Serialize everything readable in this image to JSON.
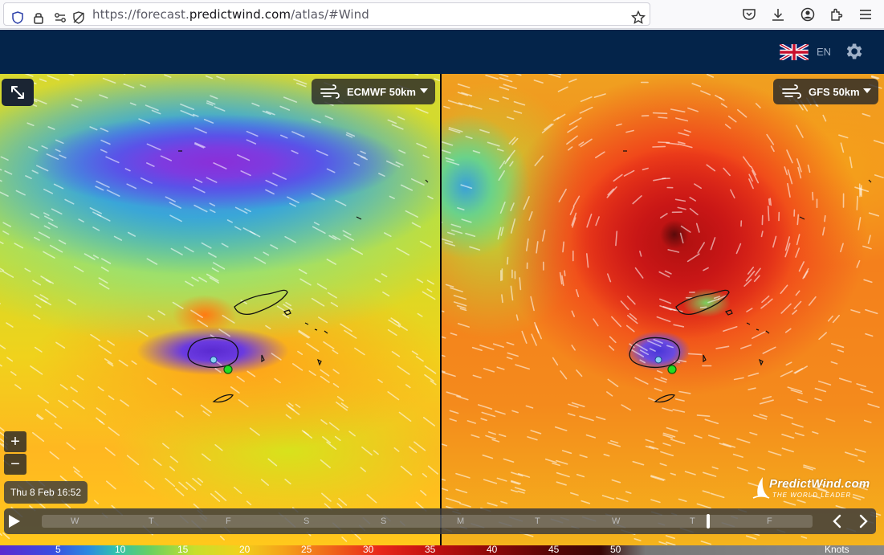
{
  "browser": {
    "url_prefix": "https://forecast.",
    "url_domain": "predictwind.com",
    "url_suffix": "/atlas/#Wind"
  },
  "header": {
    "language": "EN"
  },
  "models": {
    "left": "ECMWF 50km",
    "right": "GFS 50km"
  },
  "zoom": {
    "in": "+",
    "out": "−"
  },
  "datetime": "Thu 8 Feb 16:52",
  "logo": {
    "name": "PredictWind.com",
    "tagline": "THE WORLD LEADER"
  },
  "timeline": {
    "days": [
      "W",
      "T",
      "F",
      "S",
      "S",
      "M",
      "T",
      "W",
      "T",
      "F"
    ],
    "position": 0.865
  },
  "legend": {
    "values": [
      "5",
      "10",
      "15",
      "20",
      "25",
      "30",
      "35",
      "40",
      "45",
      "50"
    ],
    "unit": "Knots"
  }
}
